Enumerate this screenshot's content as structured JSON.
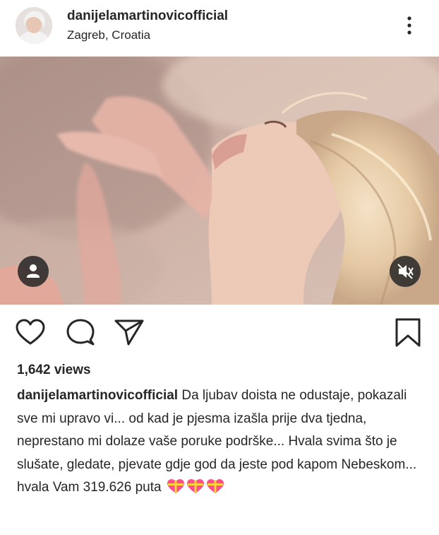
{
  "post": {
    "username": "danijelamartinovicofficial",
    "location": "Zagreb, Croatia",
    "views": "1,642 views",
    "caption_username": "danijelamartinovicofficial",
    "caption_text": "Da ljubav doista ne odustaje, pokazali sve mi upravo vi... od kad je pjesma izašla prije dva tjedna, neprestano mi dolaze vaše poruke podrške... Hvala svima što je slušate, gledate, pjevate gdje god da jeste pod kapom Nebeskom... hvala Vam 319.626 puta"
  },
  "icons": {
    "avatar": "profile-photo",
    "more": "more-vertical-icon",
    "user_tag": "user-icon",
    "mute": "volume-muted-icon",
    "like": "heart-icon",
    "comment": "comment-icon",
    "share": "paper-plane-icon",
    "save": "bookmark-icon",
    "caption_emoji": "gift-heart-emoji"
  },
  "colors": {
    "text": "#262626",
    "background": "#ffffff",
    "overlay": "#262626",
    "emoji_heart": "#ff4f8a",
    "emoji_ribbon": "#ffd43b"
  }
}
